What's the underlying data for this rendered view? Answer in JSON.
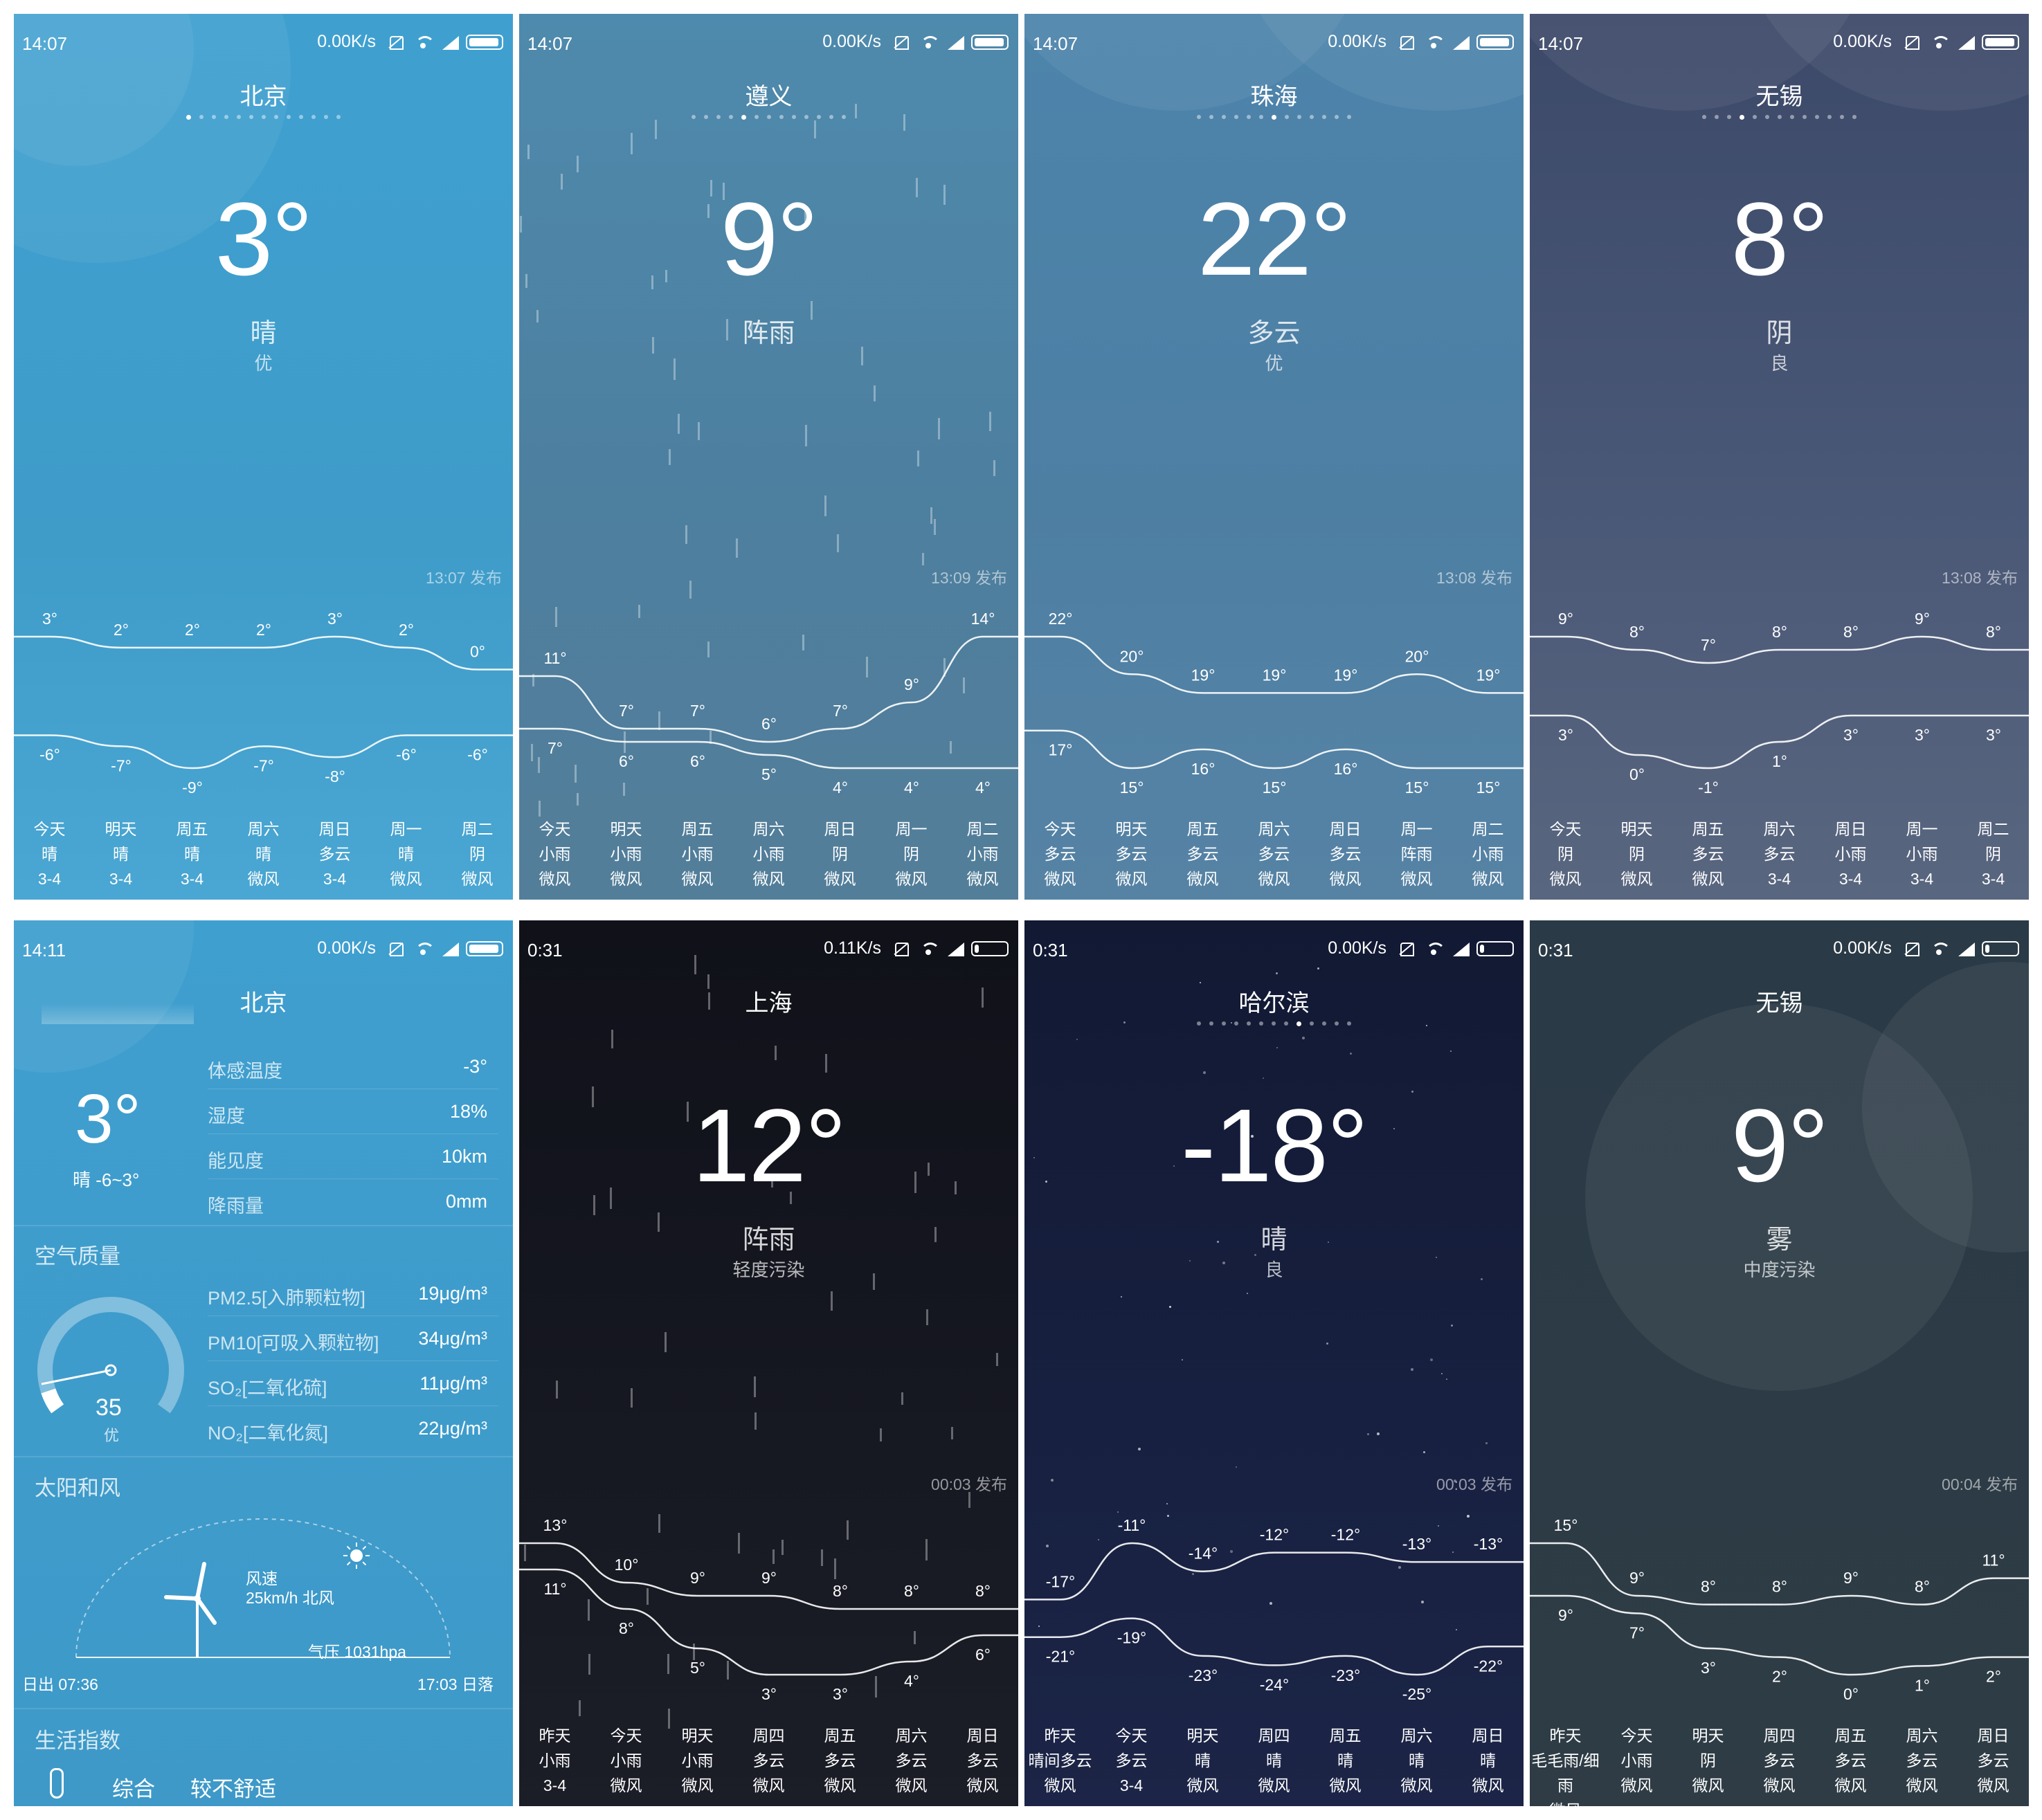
{
  "panels": [
    {
      "status": {
        "time": "14:07",
        "speed": "0.00K/s"
      },
      "city": "北京",
      "temp": "3°",
      "condition": "晴",
      "aqi": "优",
      "published": "13:07 发布",
      "dots": 0,
      "high": [
        "3°",
        "2°",
        "2°",
        "2°",
        "3°",
        "2°",
        "0°"
      ],
      "low": [
        "-6°",
        "-7°",
        "-9°",
        "-7°",
        "-8°",
        "-6°",
        "-6°"
      ],
      "days": [
        [
          "今天",
          "晴",
          "3-4"
        ],
        [
          "明天",
          "晴",
          "3-4"
        ],
        [
          "周五",
          "晴",
          "3-4"
        ],
        [
          "周六",
          "晴",
          "微风"
        ],
        [
          "周日",
          "多云",
          "3-4"
        ],
        [
          "周一",
          "晴",
          "微风"
        ],
        [
          "周二",
          "阴",
          "微风"
        ]
      ]
    },
    {
      "status": {
        "time": "14:07",
        "speed": "0.00K/s"
      },
      "city": "遵义",
      "temp": "9°",
      "condition": "阵雨",
      "aqi": "",
      "published": "13:09 发布",
      "dots": 4,
      "high": [
        "11°",
        "7°",
        "7°",
        "6°",
        "7°",
        "9°",
        "14°"
      ],
      "low": [
        "7°",
        "6°",
        "6°",
        "5°",
        "4°",
        "4°",
        "4°"
      ],
      "days": [
        [
          "今天",
          "小雨",
          "微风"
        ],
        [
          "明天",
          "小雨",
          "微风"
        ],
        [
          "周五",
          "小雨",
          "微风"
        ],
        [
          "周六",
          "小雨",
          "微风"
        ],
        [
          "周日",
          "阴",
          "微风"
        ],
        [
          "周一",
          "阴",
          "微风"
        ],
        [
          "周二",
          "小雨",
          "微风"
        ]
      ]
    },
    {
      "status": {
        "time": "14:07",
        "speed": "0.00K/s"
      },
      "city": "珠海",
      "temp": "22°",
      "condition": "多云",
      "aqi": "优",
      "published": "13:08 发布",
      "dots": 6,
      "high": [
        "22°",
        "20°",
        "19°",
        "19°",
        "19°",
        "20°",
        "19°"
      ],
      "low": [
        "17°",
        "15°",
        "16°",
        "15°",
        "16°",
        "15°",
        "15°"
      ],
      "days": [
        [
          "今天",
          "多云",
          "微风"
        ],
        [
          "明天",
          "多云",
          "微风"
        ],
        [
          "周五",
          "多云",
          "微风"
        ],
        [
          "周六",
          "多云",
          "微风"
        ],
        [
          "周日",
          "多云",
          "微风"
        ],
        [
          "周一",
          "阵雨",
          "微风"
        ],
        [
          "周二",
          "小雨",
          "微风"
        ]
      ]
    },
    {
      "status": {
        "time": "14:07",
        "speed": "0.00K/s"
      },
      "city": "无锡",
      "temp": "8°",
      "condition": "阴",
      "aqi": "良",
      "published": "13:08 发布",
      "dots": 3,
      "high": [
        "9°",
        "8°",
        "7°",
        "8°",
        "8°",
        "9°",
        "8°"
      ],
      "low": [
        "3°",
        "0°",
        "-1°",
        "1°",
        "3°",
        "3°",
        "3°"
      ],
      "days": [
        [
          "今天",
          "阴",
          "微风"
        ],
        [
          "明天",
          "阴",
          "微风"
        ],
        [
          "周五",
          "多云",
          "微风"
        ],
        [
          "周六",
          "多云",
          "3-4"
        ],
        [
          "周日",
          "小雨",
          "3-4"
        ],
        [
          "周一",
          "小雨",
          "3-4"
        ],
        [
          "周二",
          "阴",
          "3-4"
        ]
      ]
    },
    {
      "status": {
        "time": "0:31",
        "speed": "0.11K/s"
      },
      "city": "上海",
      "temp": "12°",
      "condition": "阵雨",
      "aqi": "轻度污染",
      "published": "00:03 发布",
      "dots": -1,
      "high": [
        "13°",
        "10°",
        "9°",
        "9°",
        "8°",
        "8°",
        "8°"
      ],
      "low": [
        "11°",
        "8°",
        "5°",
        "3°",
        "3°",
        "4°",
        "6°"
      ],
      "days": [
        [
          "昨天",
          "小雨",
          "3-4"
        ],
        [
          "今天",
          "小雨",
          "微风"
        ],
        [
          "明天",
          "小雨",
          "微风"
        ],
        [
          "周四",
          "多云",
          "微风"
        ],
        [
          "周五",
          "多云",
          "微风"
        ],
        [
          "周六",
          "多云",
          "微风"
        ],
        [
          "周日",
          "多云",
          "微风"
        ]
      ]
    },
    {
      "status": {
        "time": "0:31",
        "speed": "0.00K/s"
      },
      "city": "哈尔滨",
      "temp": "-18°",
      "condition": "晴",
      "aqi": "良",
      "published": "00:03 发布",
      "dots": 8,
      "high": [
        "-17°",
        "-11°",
        "-14°",
        "-12°",
        "-12°",
        "-13°",
        "-13°"
      ],
      "low": [
        "-21°",
        "-19°",
        "-23°",
        "-24°",
        "-23°",
        "-25°",
        "-22°"
      ],
      "days": [
        [
          "昨天",
          "晴间多云",
          "微风"
        ],
        [
          "今天",
          "多云",
          "3-4"
        ],
        [
          "明天",
          "晴",
          "微风"
        ],
        [
          "周四",
          "晴",
          "微风"
        ],
        [
          "周五",
          "晴",
          "微风"
        ],
        [
          "周六",
          "晴",
          "微风"
        ],
        [
          "周日",
          "晴",
          "微风"
        ]
      ]
    },
    {
      "status": {
        "time": "0:31",
        "speed": "0.00K/s"
      },
      "city": "无锡",
      "temp": "9°",
      "condition": "雾",
      "aqi": "中度污染",
      "published": "00:04 发布",
      "dots": -1,
      "high": [
        "15°",
        "9°",
        "8°",
        "8°",
        "9°",
        "8°",
        "11°"
      ],
      "low": [
        "9°",
        "7°",
        "3°",
        "2°",
        "0°",
        "1°",
        "2°"
      ],
      "days": [
        [
          "昨天",
          "毛毛雨/细雨",
          "微风"
        ],
        [
          "今天",
          "小雨",
          "微风"
        ],
        [
          "明天",
          "阴",
          "微风"
        ],
        [
          "周四",
          "多云",
          "微风"
        ],
        [
          "周五",
          "多云",
          "微风"
        ],
        [
          "周六",
          "多云",
          "微风"
        ],
        [
          "周日",
          "多云",
          "微风"
        ]
      ]
    }
  ],
  "detail": {
    "status": {
      "time": "14:11",
      "speed": "0.00K/s"
    },
    "city": "北京",
    "temp": "3°",
    "sub": "晴  -6~3°",
    "rows": [
      {
        "k": "体感温度",
        "v": "-3°"
      },
      {
        "k": "湿度",
        "v": "18%"
      },
      {
        "k": "能见度",
        "v": "10km"
      },
      {
        "k": "降雨量",
        "v": "0mm"
      }
    ],
    "aq_title": "空气质量",
    "aq_value": "35",
    "aq_level": "优",
    "aq_gauge_fraction": 0.07,
    "aq_rows": [
      {
        "k": "PM2.5[入肺颗粒物]",
        "v": "19μg/m³"
      },
      {
        "k": "PM10[可吸入颗粒物]",
        "v": "34μg/m³"
      },
      {
        "k": "SO₂[二氧化硫]",
        "v": "11μg/m³"
      },
      {
        "k": "NO₂[二氧化氮]",
        "v": "22μg/m³"
      }
    ],
    "sun_title": "太阳和风",
    "wind_label": "风速",
    "wind_value": "25km/h 北风",
    "pressure": "气压 1031hpa",
    "sunrise": "日出 07:36",
    "sunset": "17:03 日落",
    "life_title": "生活指数",
    "life_item": "综合",
    "life_value": "较不舒适"
  }
}
